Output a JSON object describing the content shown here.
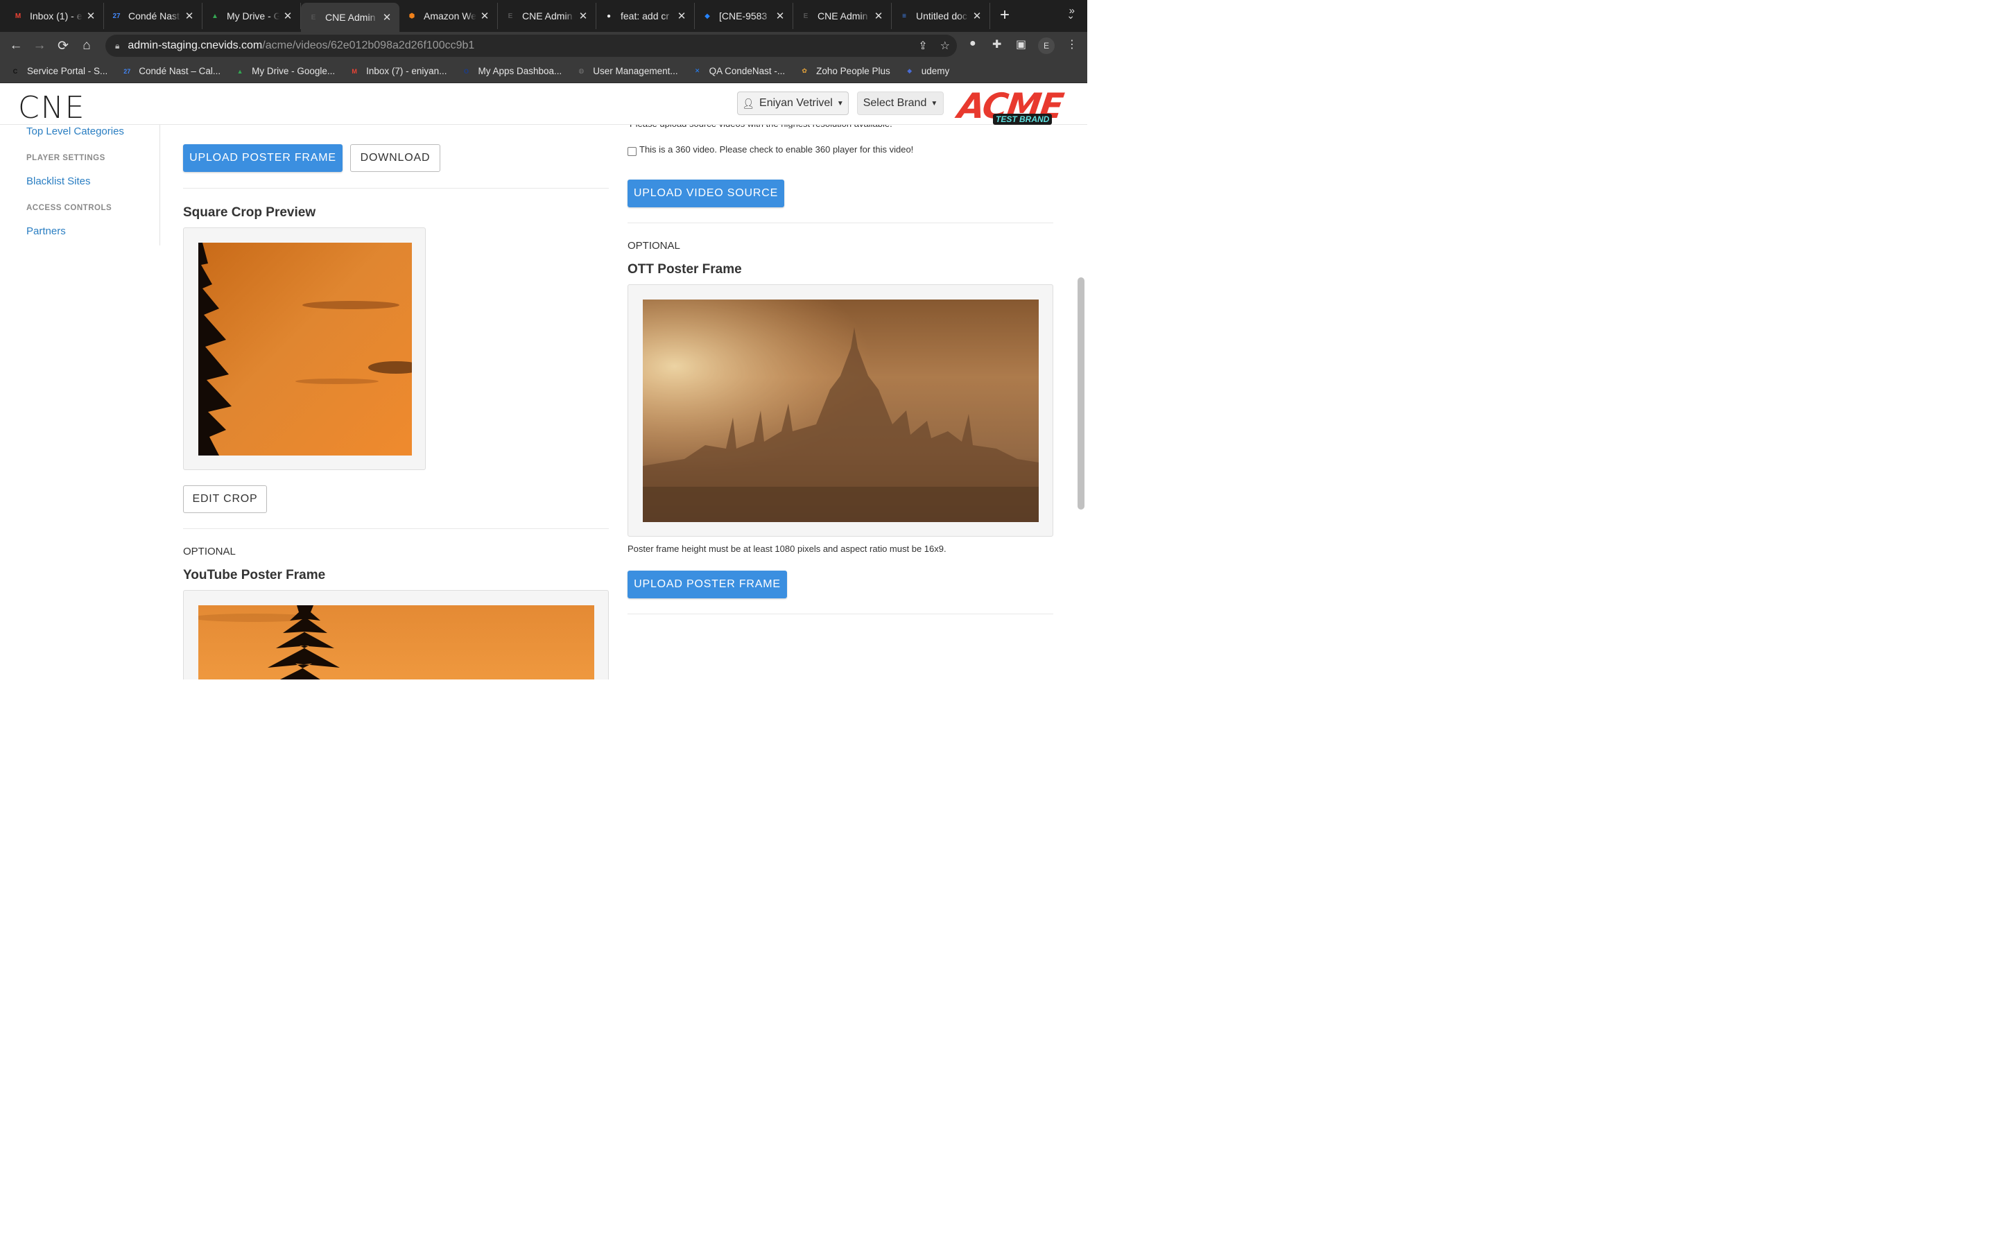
{
  "browser": {
    "tabs": [
      {
        "label": "Inbox (1) - e",
        "icon": "gmail-icon",
        "color": "#ea4335",
        "glyph": "M"
      },
      {
        "label": "Condé Nast",
        "icon": "calendar-icon",
        "color": "#4285f4",
        "glyph": "27"
      },
      {
        "label": "My Drive - G",
        "icon": "drive-icon",
        "color": "#34a853",
        "glyph": "▲"
      },
      {
        "label": "CNE Admin",
        "icon": "cne-icon",
        "color": "#555555",
        "glyph": "E",
        "active": true
      },
      {
        "label": "Amazon We",
        "icon": "aws-icon",
        "color": "#f0811a",
        "glyph": "⬢"
      },
      {
        "label": "CNE Admin",
        "icon": "cne-icon",
        "color": "#555555",
        "glyph": "E"
      },
      {
        "label": "feat: add cr",
        "icon": "github-icon",
        "color": "#eeeeee",
        "glyph": "●"
      },
      {
        "label": "[CNE-9583",
        "icon": "jira-icon",
        "color": "#2684ff",
        "glyph": "◆"
      },
      {
        "label": "CNE Admin",
        "icon": "cne-icon",
        "color": "#555555",
        "glyph": "E"
      },
      {
        "label": "Untitled doc",
        "icon": "docs-icon",
        "color": "#4285f4",
        "glyph": "≡"
      }
    ],
    "url_host": "admin-staging.cnevids.com",
    "url_path": "/acme/videos/62e012b098a2d26f100cc9b1",
    "profile_initial": "E",
    "bookmarks": [
      {
        "label": "Service Portal - S...",
        "icon": "service-portal-icon",
        "color": "#111111",
        "glyph": "C"
      },
      {
        "label": "Condé Nast – Cal...",
        "icon": "calendar-icon",
        "color": "#4285f4",
        "glyph": "27"
      },
      {
        "label": "My Drive - Google...",
        "icon": "drive-icon",
        "color": "#34a853",
        "glyph": "▲"
      },
      {
        "label": "Inbox (7) - eniyan...",
        "icon": "gmail-icon",
        "color": "#ea4335",
        "glyph": "M"
      },
      {
        "label": "My Apps Dashboa...",
        "icon": "okta-icon",
        "color": "#1a3c8a",
        "glyph": "O"
      },
      {
        "label": "User Management...",
        "icon": "globe-icon",
        "color": "#777777",
        "glyph": "◍"
      },
      {
        "label": "QA CondeNast -...",
        "icon": "confluence-icon",
        "color": "#2684ff",
        "glyph": "✕"
      },
      {
        "label": "Zoho People Plus",
        "icon": "zoho-icon",
        "color": "#e7a43a",
        "glyph": "✿"
      },
      {
        "label": "udemy",
        "icon": "udemy-icon",
        "color": "#4a6cd4",
        "glyph": "◆"
      }
    ]
  },
  "header": {
    "logo": "CNE",
    "user_name": "Eniyan Vetrivel",
    "select_brand": "Select Brand",
    "brand_logo_word": "ACME",
    "brand_logo_tag": "TEST BRAND"
  },
  "sidebar": {
    "top_link": "Top Level Categories",
    "player_settings_heading": "PLAYER SETTINGS",
    "blacklist": "Blacklist Sites",
    "access_heading": "ACCESS CONTROLS",
    "partners": "Partners"
  },
  "left": {
    "upload_poster": "UPLOAD POSTER FRAME",
    "download": "DOWNLOAD",
    "square_title": "Square Crop Preview",
    "edit_crop": "EDIT CROP",
    "optional": "OPTIONAL",
    "youtube_title": "YouTube Poster Frame"
  },
  "right": {
    "cut_note": "Please upload source videos with the highest resolution available.",
    "checkbox_label": "This is a 360 video. Please check to enable 360 player for this video!",
    "upload_video": "UPLOAD VIDEO SOURCE",
    "optional": "OPTIONAL",
    "ott_title": "OTT Poster Frame",
    "ott_note": "Poster frame height must be at least 1080 pixels and aspect ratio must be 16x9.",
    "upload_poster": "UPLOAD POSTER FRAME"
  },
  "colors": {
    "primary_button": "#3b8fe0",
    "link": "#2a7ec2",
    "brand_red": "#e8392e"
  }
}
